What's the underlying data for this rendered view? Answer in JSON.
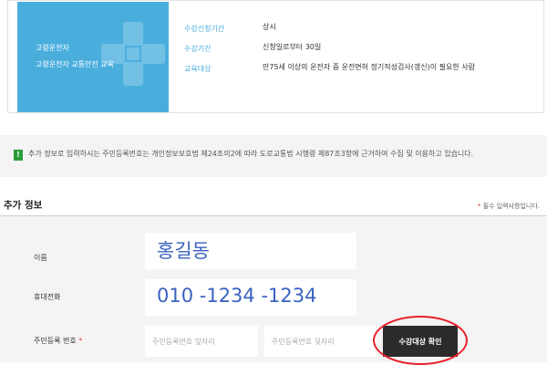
{
  "course": {
    "tile_title": "고령운전자",
    "tile_subtitle": "고령운전자 교통안전 교육",
    "rows": [
      {
        "label": "수강신청기간",
        "value": "상시"
      },
      {
        "label": "수강기간",
        "value": "신청일로부터 30일"
      },
      {
        "label": "교육대상",
        "value": "만75세 이상의 운전자 중 운전면허 정기적성검사(갱신)이 필요한 사람"
      }
    ]
  },
  "notice": {
    "icon": "info-icon",
    "text": "추가 정보로 입력하시는 주민등록번호는 개인정보보호법 제24조의2에 따라 도로교통법 시행령 제87조3항에 근거하여 수집 및 이용하고 있습니다."
  },
  "section": {
    "title": "추가 정보",
    "required_star": "*",
    "required_note": "필수 입력사항입니다."
  },
  "form": {
    "name_label": "이름",
    "name_value": "홍길동",
    "phone_label": "휴대전화",
    "phone_value": "010 -1234 -1234",
    "rrn_label": "주민등록 번호",
    "rrn_star": "*",
    "rrn_front_placeholder": "주민등록번호 앞자리",
    "rrn_back_placeholder": "주민등록번호 뒷자리",
    "check_button": "수강대상 확인"
  },
  "colors": {
    "accent": "#4aaedd",
    "annotation": "#e8202a",
    "value_text": "#3a62c0"
  }
}
